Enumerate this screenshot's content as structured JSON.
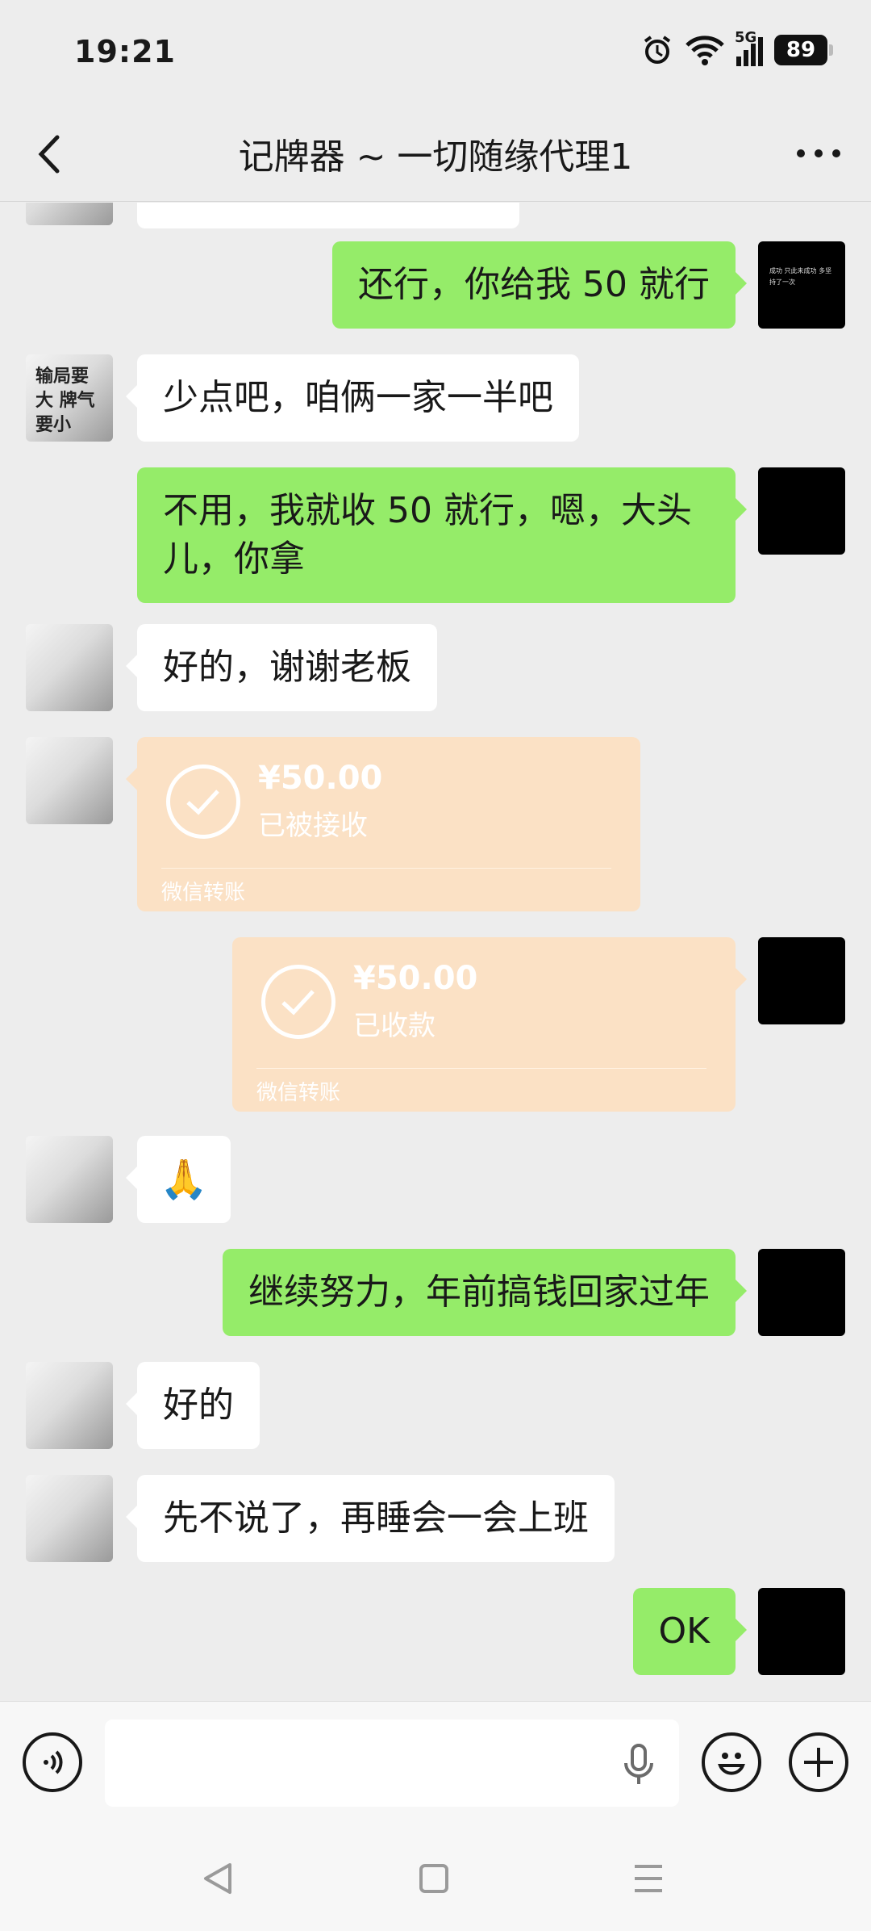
{
  "status_bar": {
    "time": "19:21",
    "network": "5G",
    "battery": "89"
  },
  "header": {
    "title": "记牌器 ~ 一切随缘代理1"
  },
  "messages": [
    {
      "side": "right",
      "text": "还行，你给我 50 就行"
    },
    {
      "side": "left",
      "text": "少点吧，咱俩一家一半吧"
    },
    {
      "side": "right",
      "text": "不用，我就收 50 就行，嗯，大头儿，你拿"
    },
    {
      "side": "left",
      "text": "好的，谢谢老板"
    },
    {
      "side": "left",
      "type": "transfer",
      "amount": "¥50.00",
      "status": "已被接收",
      "footer": "微信转账"
    },
    {
      "side": "right",
      "type": "transfer",
      "amount": "¥50.00",
      "status": "已收款",
      "footer": "微信转账"
    },
    {
      "side": "left",
      "text": "🙏"
    },
    {
      "side": "right",
      "text": "继续努力，年前搞钱回家过年"
    },
    {
      "side": "left",
      "text": "好的"
    },
    {
      "side": "left",
      "text": "先不说了，再睡会一会上班"
    },
    {
      "side": "right",
      "text": "OK"
    }
  ],
  "avatars": {
    "left_text": "输局要大 牌气要小",
    "right_text": "成功 只此未成功 多坚持了一次"
  },
  "input": {
    "placeholder": ""
  },
  "icons": {
    "back": "chevron-left-icon",
    "more": "more-dots-icon",
    "voice": "voice-icon",
    "mic": "microphone-icon",
    "emoji": "emoji-icon",
    "plus": "plus-icon",
    "transfer": "check-circle-icon"
  },
  "colors": {
    "my_bubble": "#95ec69",
    "their_bubble": "#ffffff",
    "transfer": "#fbe1c5",
    "background": "#ededed"
  }
}
